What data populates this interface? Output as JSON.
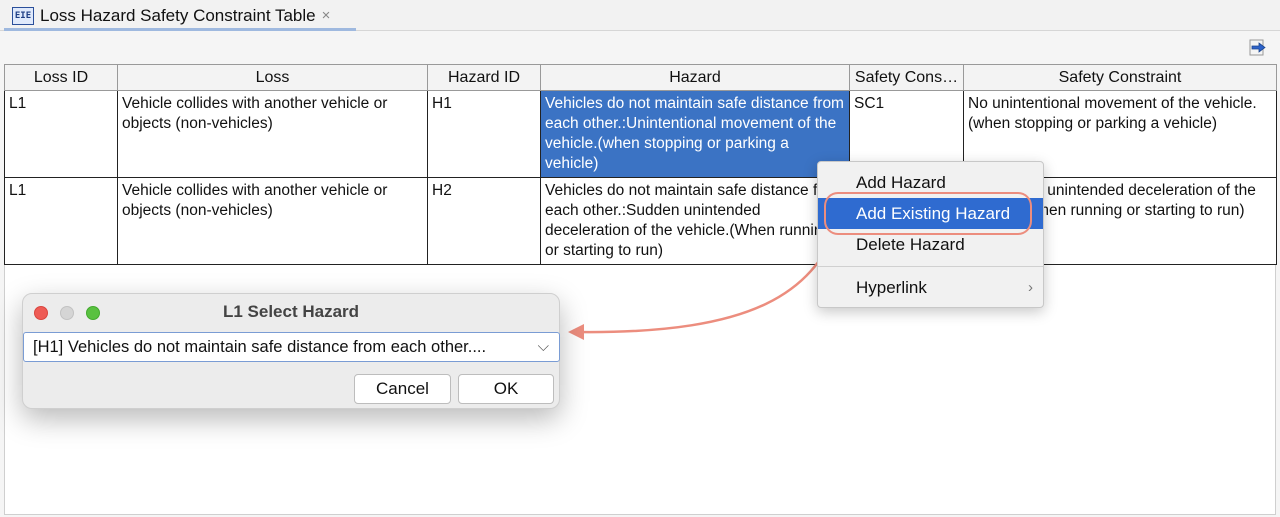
{
  "tab": {
    "title": "Loss Hazard Safety Constraint Table",
    "close_glyph": "×"
  },
  "toolbar": {
    "export_icon": "export-arrow-icon"
  },
  "table": {
    "columns": [
      "Loss ID",
      "Loss",
      "Hazard ID",
      "Hazard",
      "Safety Cons…",
      "Safety Constraint"
    ],
    "rows": [
      {
        "loss_id": "L1",
        "loss": "Vehicle collides with another vehicle or objects (non-vehicles)",
        "hazard_id": "H1",
        "hazard": "Vehicles do not maintain safe distance from each other.:Unintentional movement of the vehicle.(when stopping or parking a vehicle)",
        "sc_id": "SC1",
        "safety_constraint": "No unintentional movement of the vehicle.(when stopping or parking a vehicle)"
      },
      {
        "loss_id": "L1",
        "loss": "Vehicle collides with another vehicle or objects (non-vehicles)",
        "hazard_id": "H2",
        "hazard": "Vehicles do not maintain safe distance from each other.:Sudden unintended deceleration of the vehicle.(When running or starting to run)",
        "sc_id": "",
        "safety_constraint": "No sudden unintended deceleration of the vehicle.(When running or starting to run)"
      }
    ]
  },
  "context_menu": {
    "items": [
      "Add Hazard",
      "Add Existing Hazard",
      "Delete Hazard",
      "Hyperlink"
    ],
    "highlighted": "Add Existing Hazard",
    "submenu_glyph": "›"
  },
  "dialog": {
    "title": "L1 Select Hazard",
    "selected_value": "[H1] Vehicles do not maintain safe distance from each other....",
    "cancel_label": "Cancel",
    "ok_label": "OK",
    "chevron": "⌵"
  },
  "colors": {
    "selection": "#3b73c4",
    "menu_highlight": "#2f6bd0",
    "annotation": "#ec8d7e"
  }
}
